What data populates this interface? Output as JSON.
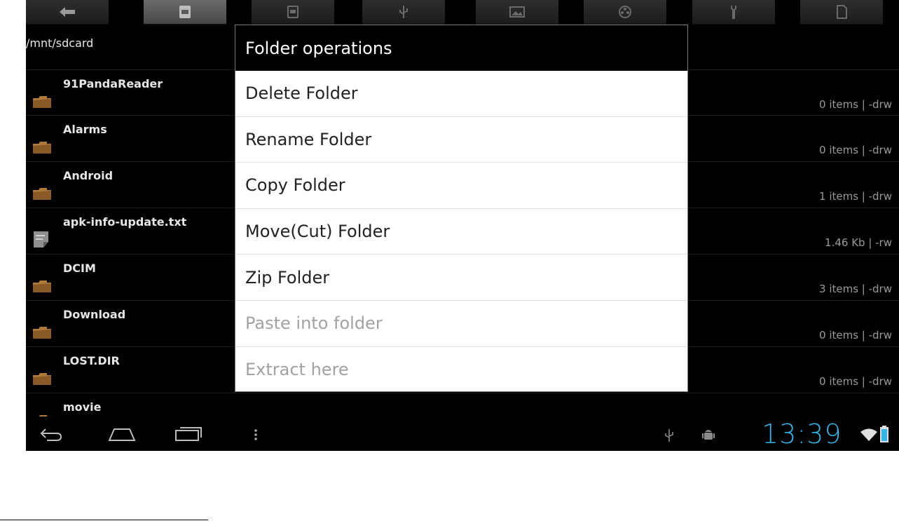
{
  "toolbar": {
    "buttons": [
      {
        "icon": "back-arrow-icon"
      },
      {
        "icon": "sdcard-icon",
        "active": true
      },
      {
        "icon": "sd-icon"
      },
      {
        "icon": "usb-icon"
      },
      {
        "icon": "picture-icon"
      },
      {
        "icon": "film-reel-icon"
      },
      {
        "icon": "tools-icon"
      },
      {
        "icon": "document-icon"
      }
    ]
  },
  "path": "/mnt/sdcard",
  "files": [
    {
      "name": "91PandaReader",
      "meta": "0 items | -drw",
      "type": "folder"
    },
    {
      "name": "Alarms",
      "meta": "0 items | -drw",
      "type": "folder"
    },
    {
      "name": "Android",
      "meta": "1 items | -drw",
      "type": "folder"
    },
    {
      "name": "apk-info-update.txt",
      "meta": "1.46 Kb  | -rw",
      "type": "text"
    },
    {
      "name": "DCIM",
      "meta": "3 items | -drw",
      "type": "folder"
    },
    {
      "name": "Download",
      "meta": "0 items | -drw",
      "type": "folder"
    },
    {
      "name": "LOST.DIR",
      "meta": "0 items | -drw",
      "type": "folder"
    },
    {
      "name": "movie",
      "meta": "",
      "type": "folder"
    }
  ],
  "dialog": {
    "title": "Folder operations",
    "items": [
      {
        "label": "Delete Folder",
        "enabled": true
      },
      {
        "label": "Rename Folder",
        "enabled": true
      },
      {
        "label": "Copy Folder",
        "enabled": true
      },
      {
        "label": "Move(Cut) Folder",
        "enabled": true
      },
      {
        "label": "Zip Folder",
        "enabled": true
      },
      {
        "label": "Paste into folder",
        "enabled": false
      },
      {
        "label": "Extract here",
        "enabled": false
      }
    ]
  },
  "statusbar": {
    "time": "13:39"
  },
  "colors": {
    "accent": "#33b5e5",
    "folder": "#b07a3a",
    "dialog_title_bg": "#000000",
    "disabled_text": "#a2a2a2"
  }
}
